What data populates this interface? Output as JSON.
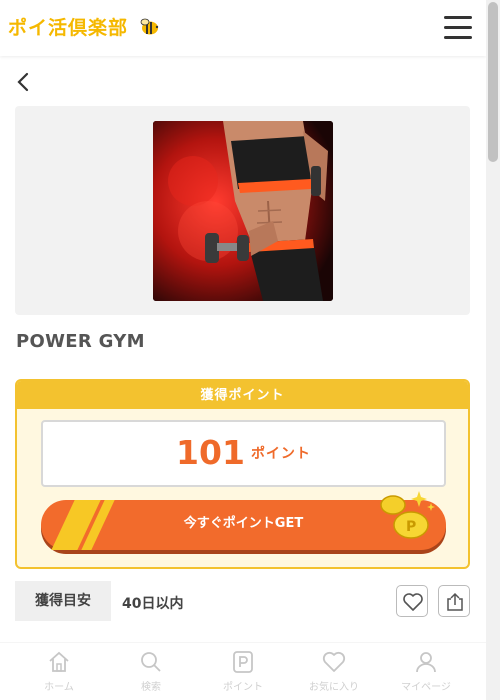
{
  "header": {
    "logo_text": "ポイ活倶楽部",
    "logo_icon": "bee-icon",
    "menu_icon": "hamburger-menu-icon"
  },
  "nav": {
    "back_icon": "chevron-left-icon"
  },
  "offer": {
    "title": "POWER GYM",
    "image": "fitness-woman-with-dumbbells",
    "points_header": "獲得ポイント",
    "points_value": "101",
    "points_unit": "ポイント",
    "get_button": "今すぐポイントGET",
    "meta_label": "獲得目安",
    "meta_value": "40日以内",
    "favorite_icon": "heart-icon",
    "share_icon": "share-icon"
  },
  "bottom_nav": [
    {
      "label": "ホーム",
      "icon": "home-icon"
    },
    {
      "label": "検索",
      "icon": "search-icon"
    },
    {
      "label": "ポイント",
      "icon": "point-p-icon"
    },
    {
      "label": "お気に入り",
      "icon": "heart-icon"
    },
    {
      "label": "マイページ",
      "icon": "user-icon"
    }
  ],
  "colors": {
    "accent_yellow": "#f3c22f",
    "accent_orange": "#f26b2c",
    "logo": "#f5b800"
  }
}
